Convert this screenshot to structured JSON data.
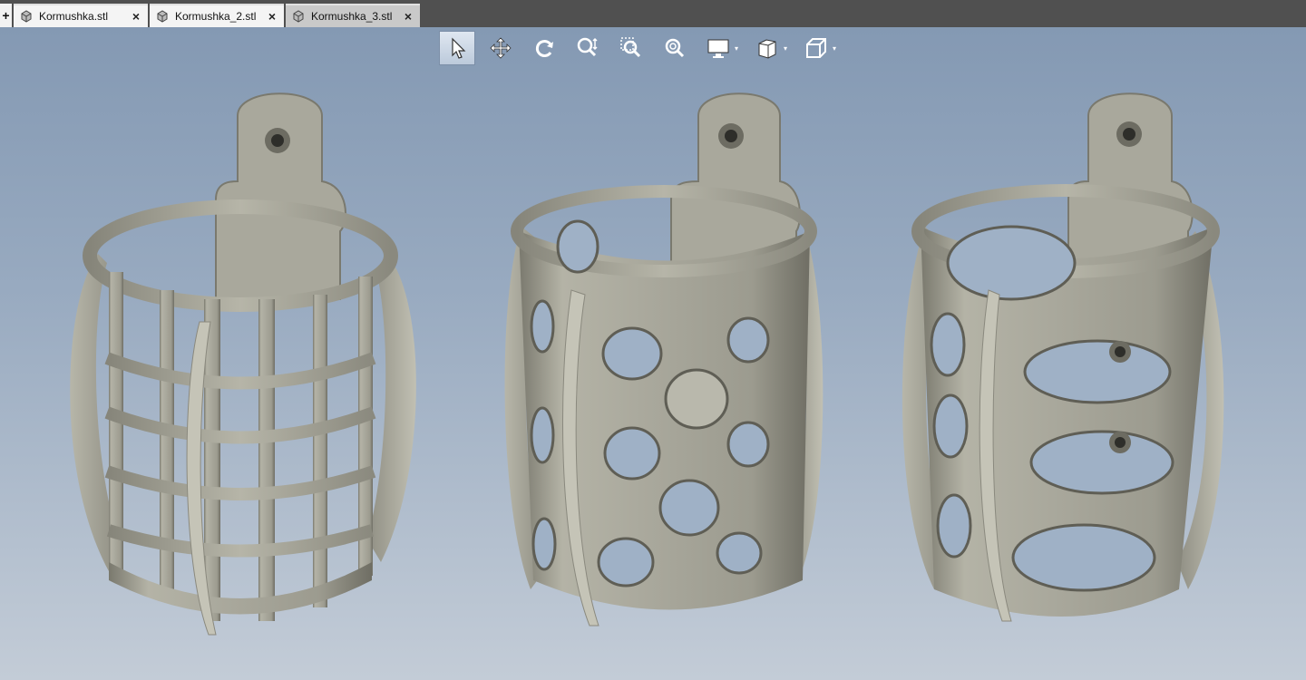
{
  "tabs": [
    {
      "label": "Kormushka.stl",
      "close": "×"
    },
    {
      "label": "Kormushka_2.stl",
      "close": "×"
    },
    {
      "label": "Kormushka_3.stl",
      "close": "×"
    }
  ],
  "add_tab": "+",
  "toolbar": {
    "dropdown_glyph": "▾",
    "tools": [
      {
        "icon": "pointer-select-icon",
        "active": true
      },
      {
        "icon": "move-pan-icon"
      },
      {
        "icon": "rotate-icon"
      },
      {
        "icon": "zoom-in-out-icon"
      },
      {
        "icon": "zoom-window-icon"
      },
      {
        "icon": "zoom-fit-icon"
      },
      {
        "icon": "display-mode-icon"
      },
      {
        "icon": "view-orientation-icon"
      },
      {
        "icon": "box-view-icon"
      }
    ]
  },
  "colors": {
    "model": "#a9a89c",
    "model_dark": "#6f6e64",
    "model_light": "#d6d5c9",
    "background_top": "#8499b3",
    "background_bottom": "#c3ccd7",
    "tabbar": "#505050"
  },
  "models": [
    {
      "name": "Kormushka",
      "style": "lattice"
    },
    {
      "name": "Kormushka_2",
      "style": "round-holes"
    },
    {
      "name": "Kormushka_3",
      "style": "oval-slots"
    }
  ]
}
